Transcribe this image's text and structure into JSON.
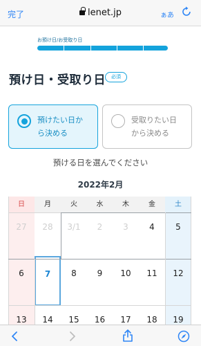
{
  "browser": {
    "done_label": "完了",
    "url": "lenet.jp",
    "text_size_label": "ぁあ"
  },
  "progress": {
    "label": "お預け日/お受取り日",
    "total_segments": 5,
    "filled_segments": 5,
    "color": "#14a3dc"
  },
  "page": {
    "title": "預け日・受取り日",
    "required_badge": "必須",
    "instruction": "預ける日を選んでください"
  },
  "options": [
    {
      "line1": "預けたい日か",
      "line2": "ら決める",
      "selected": true
    },
    {
      "line1": "受取りたい日",
      "line2": "から決める",
      "selected": false
    }
  ],
  "calendar": {
    "month_label": "2022年2月",
    "weekdays": [
      "日",
      "月",
      "火",
      "水",
      "木",
      "金",
      "土"
    ],
    "weeks": [
      [
        "27",
        "28",
        "3/1",
        "2",
        "3",
        "4",
        "5"
      ],
      [
        "6",
        "7",
        "8",
        "9",
        "10",
        "11",
        "12"
      ],
      [
        "13",
        "14",
        "15",
        "16",
        "17",
        "18",
        "19"
      ]
    ],
    "disabled_days": [
      "27",
      "28",
      "3/1",
      "2",
      "3"
    ],
    "today": "7",
    "colors": {
      "sunday": "#d84a4a",
      "saturday": "#2f86c8",
      "today": "#1c86d4"
    }
  },
  "toolbar": {
    "icons": [
      "back-icon",
      "forward-icon",
      "share-icon",
      "bookmarks-icon",
      "tabs-icon"
    ]
  }
}
